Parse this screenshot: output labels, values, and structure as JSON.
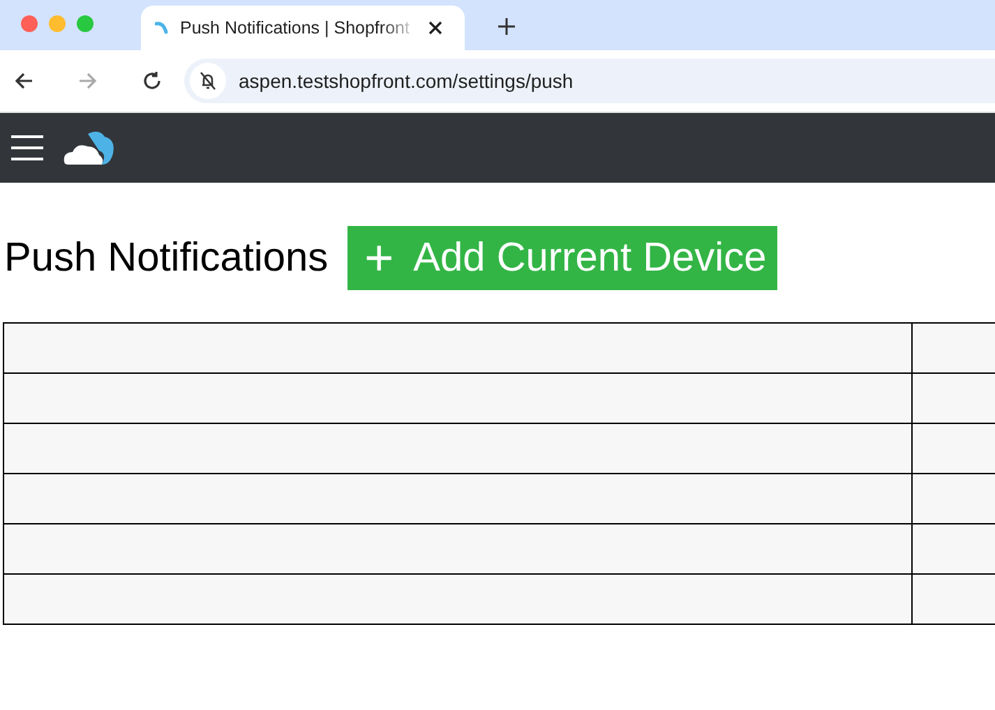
{
  "browser": {
    "tab_title": "Push Notifications | Shopfront",
    "url": "aspen.testshopfront.com/settings/push"
  },
  "page": {
    "title": "Push Notifications",
    "add_button": "+",
    "add_button_label": "Add Current Device"
  },
  "table": {
    "rows": [
      {
        "kind": "blank"
      },
      {
        "kind": "blank"
      },
      {
        "kind": "blank"
      },
      {
        "kind": "blank"
      },
      {
        "kind": "blank"
      },
      {
        "kind": "blank"
      }
    ]
  }
}
